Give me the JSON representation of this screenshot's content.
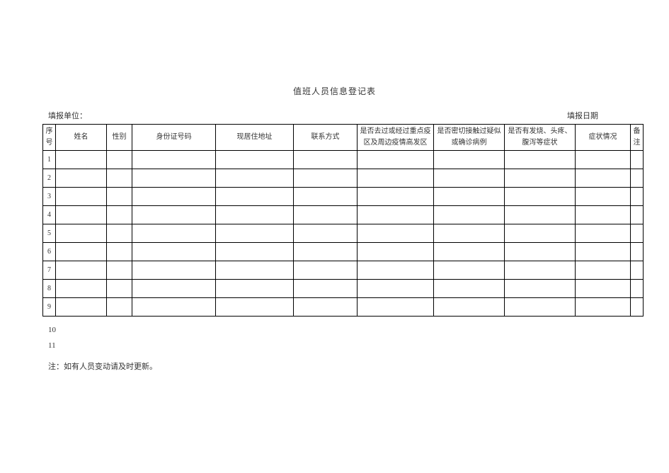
{
  "title": "值班人员信息登记表",
  "subhead_left": "填报单位：",
  "subhead_right": "填报日期",
  "columns": {
    "seq": "序号",
    "name": "姓名",
    "sex": "性别",
    "id": "身份证号码",
    "addr": "现居住地址",
    "phone": "联系方式",
    "q1": "是否去过或经过重点疫区及周边疫情高发区",
    "q2": "是否密切接触过疑似或确诊病例",
    "q3": "是否有发烧、头疼、腹泻等症状",
    "symp": "症状情况",
    "note": "备注"
  },
  "rows_in_table": [
    "1",
    "2",
    "3",
    "4",
    "5",
    "6",
    "7",
    "8",
    "9"
  ],
  "rows_outside": [
    "10",
    "11"
  ],
  "footnote": "注：如有人员变动请及时更新。"
}
